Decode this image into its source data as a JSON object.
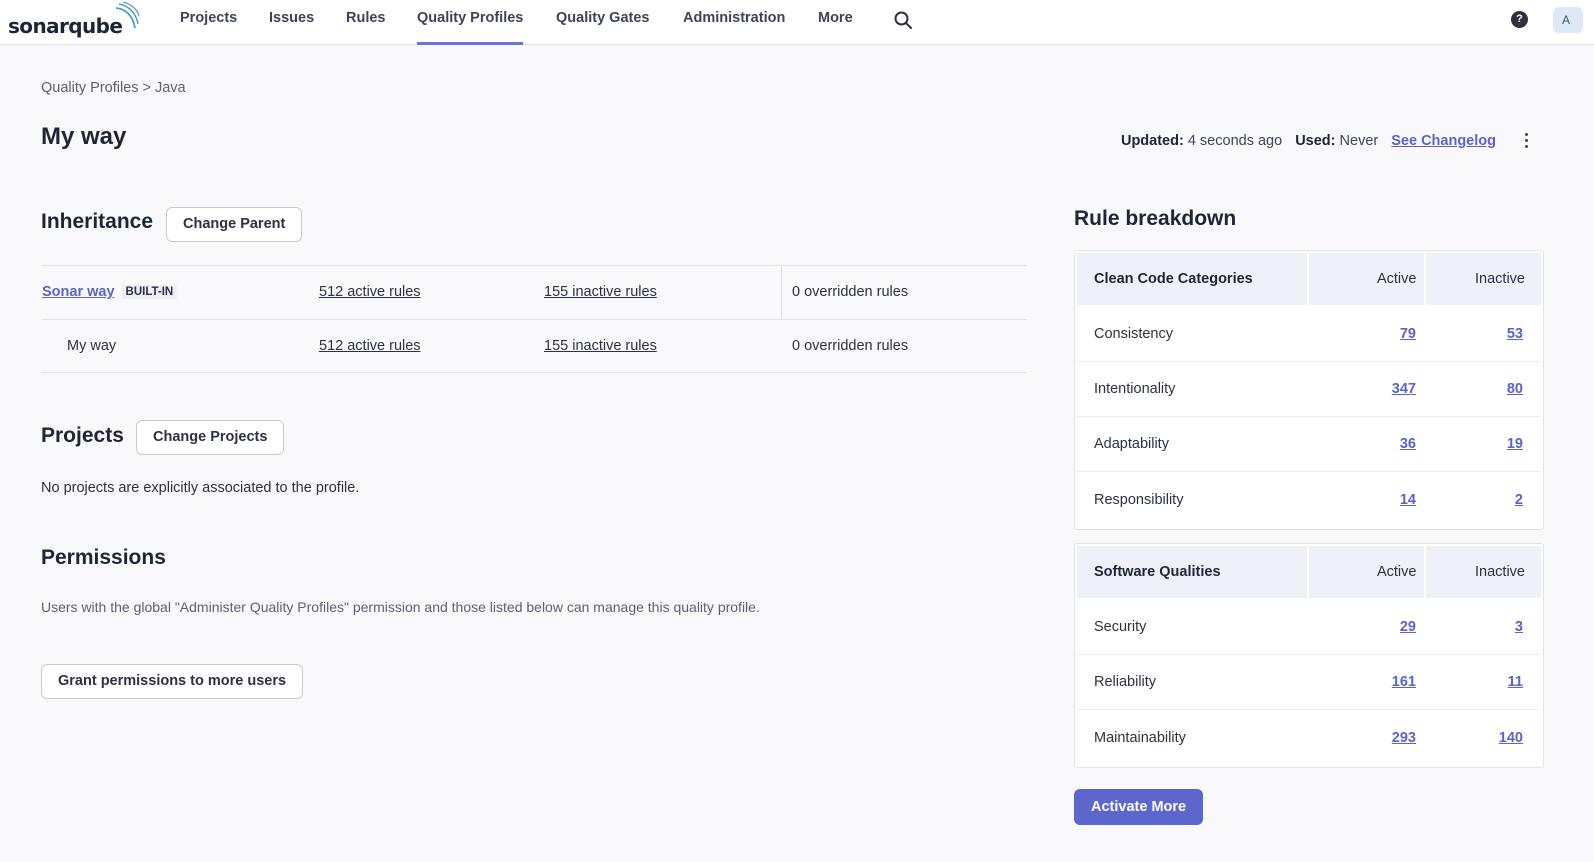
{
  "brand": {
    "logo_text": "sonarqube"
  },
  "nav": {
    "projects": "Projects",
    "issues": "Issues",
    "rules": "Rules",
    "quality_profiles": "Quality Profiles",
    "quality_gates": "Quality Gates",
    "administration": "Administration",
    "more": "More",
    "help_icon": "?",
    "avatar_initial": "A"
  },
  "breadcrumb": {
    "parent": "Quality Profiles",
    "separator": ">",
    "current": "Java"
  },
  "profile": {
    "title": "My way",
    "updated_label": "Updated:",
    "updated_value": "4 seconds ago",
    "used_label": "Used:",
    "used_value": "Never",
    "changelog_link": "See Changelog"
  },
  "inheritance": {
    "title": "Inheritance",
    "change_parent_button": "Change Parent",
    "rows": [
      {
        "name": "Sonar way",
        "badge": "BUILT-IN",
        "active": "512 active rules",
        "inactive": "155 inactive rules",
        "overridden": "0 overridden rules"
      },
      {
        "name": "My way",
        "badge": "",
        "active": "512 active rules",
        "inactive": "155 inactive rules",
        "overridden": "0 overridden rules"
      }
    ]
  },
  "projects": {
    "title": "Projects",
    "change_projects_button": "Change Projects",
    "empty_message": "No projects are explicitly associated to the profile."
  },
  "permissions": {
    "title": "Permissions",
    "description": "Users with the global \"Administer Quality Profiles\" permission and those listed below can manage this quality profile.",
    "grant_button": "Grant permissions to more users"
  },
  "rule_breakdown": {
    "title": "Rule breakdown",
    "clean_code": {
      "header": "Clean Code Categories",
      "active_header": "Active",
      "inactive_header": "Inactive",
      "rows": [
        {
          "label": "Consistency",
          "active": "79",
          "inactive": "53"
        },
        {
          "label": "Intentionality",
          "active": "347",
          "inactive": "80"
        },
        {
          "label": "Adaptability",
          "active": "36",
          "inactive": "19"
        },
        {
          "label": "Responsibility",
          "active": "14",
          "inactive": "2"
        }
      ]
    },
    "software_qualities": {
      "header": "Software Qualities",
      "active_header": "Active",
      "inactive_header": "Inactive",
      "rows": [
        {
          "label": "Security",
          "active": "29",
          "inactive": "3"
        },
        {
          "label": "Reliability",
          "active": "161",
          "inactive": "11"
        },
        {
          "label": "Maintainability",
          "active": "293",
          "inactive": "140"
        }
      ]
    },
    "activate_more_button": "Activate More"
  },
  "colors": {
    "accent": "#5d66cc",
    "link": "#5b63c7",
    "background": "#f9f9fb"
  }
}
